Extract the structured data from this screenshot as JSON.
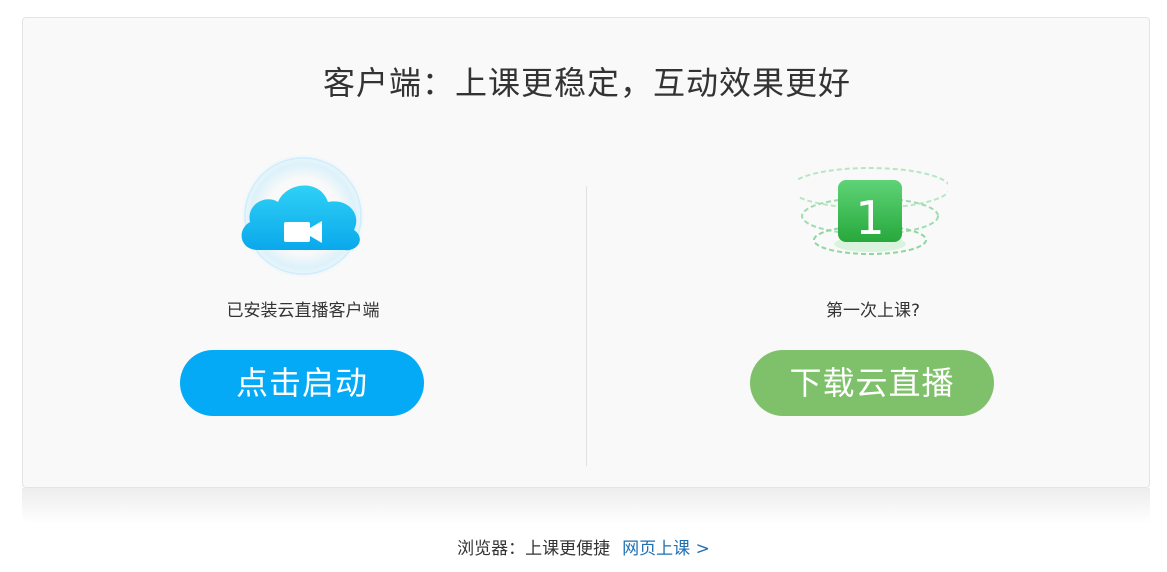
{
  "header": {
    "title": "客户端：上课更稳定，互动效果更好"
  },
  "left": {
    "label": "已安装云直播客户端",
    "button": "点击启动",
    "icon": "cloud-video-icon"
  },
  "right": {
    "label": "第一次上课?",
    "button": "下载云直播",
    "icon": "badge-one-icon",
    "badge_text": "1"
  },
  "footer": {
    "text": "浏览器：上课更便捷",
    "link": "网页上课 >"
  },
  "colors": {
    "launch_button": "#04aaf6",
    "download_button": "#7fc16a",
    "link": "#1f6fb2"
  }
}
